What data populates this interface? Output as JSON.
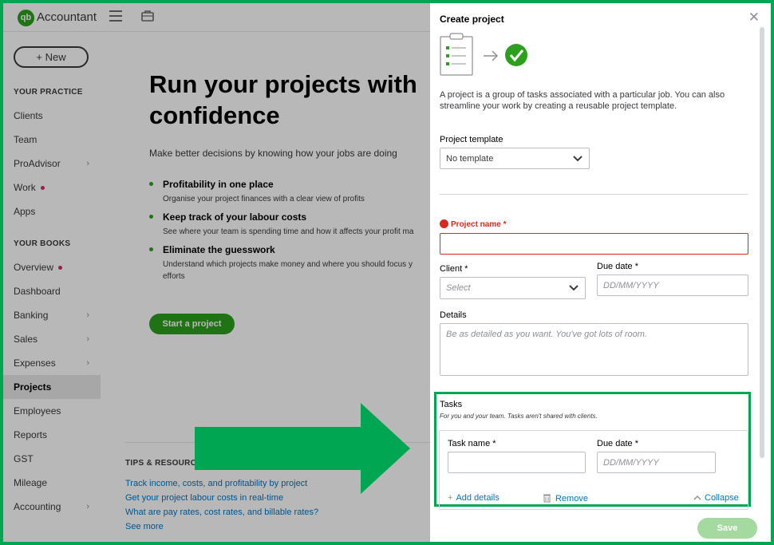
{
  "app": {
    "logo_text": "qb",
    "name": "Accountant"
  },
  "sidebar": {
    "new_label": "New",
    "practice_heading": "YOUR PRACTICE",
    "practice_items": [
      {
        "label": "Clients",
        "chevron": false,
        "dot": false
      },
      {
        "label": "Team",
        "chevron": false,
        "dot": false
      },
      {
        "label": "ProAdvisor",
        "chevron": true,
        "dot": false
      },
      {
        "label": "Work",
        "chevron": false,
        "dot": true
      },
      {
        "label": "Apps",
        "chevron": false,
        "dot": false
      }
    ],
    "books_heading": "YOUR BOOKS",
    "books_items": [
      {
        "label": "Overview",
        "chevron": false,
        "dot": true
      },
      {
        "label": "Dashboard",
        "chevron": false,
        "dot": false
      },
      {
        "label": "Banking",
        "chevron": true,
        "dot": false
      },
      {
        "label": "Sales",
        "chevron": true,
        "dot": false
      },
      {
        "label": "Expenses",
        "chevron": true,
        "dot": false
      },
      {
        "label": "Projects",
        "chevron": false,
        "dot": false,
        "active": true
      },
      {
        "label": "Employees",
        "chevron": false,
        "dot": false
      },
      {
        "label": "Reports",
        "chevron": false,
        "dot": false
      },
      {
        "label": "GST",
        "chevron": false,
        "dot": false
      },
      {
        "label": "Mileage",
        "chevron": false,
        "dot": false
      },
      {
        "label": "Accounting",
        "chevron": true,
        "dot": false
      }
    ]
  },
  "hero": {
    "title_line1": "Run your projects with",
    "title_line2": "confidence",
    "subtitle": "Make better decisions by knowing how your jobs are doing",
    "bullets": [
      {
        "title": "Profitability in one place",
        "desc": "Organise your project finances with a clear view of profits"
      },
      {
        "title": "Keep track of your labour costs",
        "desc": "See where your team is spending time and how it affects your profit ma"
      },
      {
        "title": "Eliminate the guesswork",
        "desc": "Understand which projects make money and where you should focus y",
        "desc2": "efforts"
      }
    ],
    "start_button": "Start a project"
  },
  "tips": {
    "heading": "TIPS & RESOURCES",
    "links": [
      "Track income, costs, and profitability by project",
      "Get your project labour costs in real-time",
      "What are pay rates, cost rates, and billable rates?",
      "See more"
    ]
  },
  "panel": {
    "title": "Create project",
    "close": "✕",
    "intro": "A project is a group of tasks associated with a particular job. You can also streamline your work by creating a reusable project template.",
    "template_label": "Project template",
    "template_value": "No template",
    "project_name_label": "Project name *",
    "project_name_value": "",
    "client_label": "Client *",
    "client_placeholder": "Select",
    "due_label": "Due date *",
    "due_placeholder": "DD/MM/YYYY",
    "details_label": "Details",
    "details_placeholder": "Be as detailed as you want. You've got lots of room.",
    "tasks_title": "Tasks",
    "tasks_sub": "For you and your team. Tasks aren't shared with clients.",
    "task_name_label": "Task name *",
    "task_due_label": "Due date *",
    "task_due_placeholder": "DD/MM/YYYY",
    "add_details": "Add details",
    "remove": "Remove",
    "collapse": "Collapse",
    "save": "Save"
  },
  "colors": {
    "brand_green": "#2ca01c",
    "annotation_green": "#00a651",
    "error_red": "#d52b1e",
    "link_blue": "#0077c5"
  }
}
